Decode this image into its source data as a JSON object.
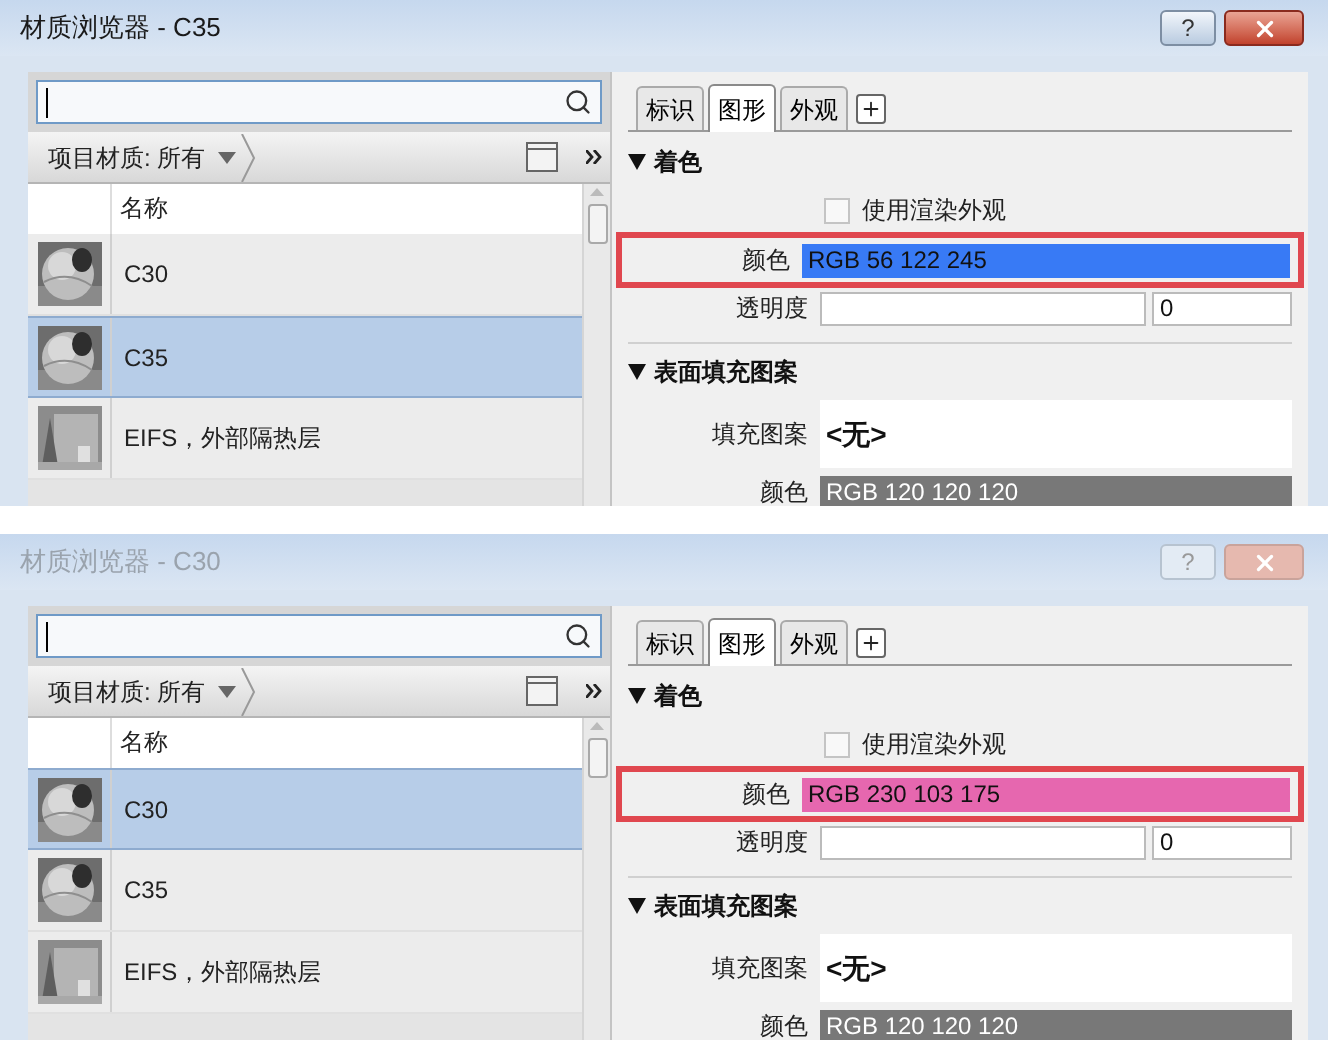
{
  "dialogs": [
    {
      "title": "材质浏览器 - C35",
      "active": true,
      "help": "?",
      "filter": "项目材质: 所有",
      "column": "名称",
      "materials": [
        {
          "name": "C30",
          "selected": false,
          "kind": "sphere"
        },
        {
          "name": "C35",
          "selected": true,
          "kind": "sphere"
        },
        {
          "name": "EIFS，外部隔热层",
          "selected": false,
          "kind": "block"
        }
      ],
      "tabs": [
        {
          "label": "标识",
          "selected": false
        },
        {
          "label": "图形",
          "selected": true
        },
        {
          "label": "外观",
          "selected": false
        }
      ],
      "shading": {
        "title": "着色",
        "render_appearance": {
          "label": "使用渲染外观",
          "checked": false
        },
        "color": {
          "label": "颜色",
          "value": "RGB 56 122 245",
          "color": "#387af5",
          "highlighted": true
        },
        "transparency": {
          "label": "透明度",
          "value": "0"
        }
      },
      "surface": {
        "title": "表面填充图案",
        "pattern": {
          "label": "填充图案",
          "value": "<无>"
        },
        "color": {
          "label": "颜色",
          "value": "RGB 120 120 120",
          "color": "#787878"
        }
      }
    },
    {
      "title": "材质浏览器 - C30",
      "active": false,
      "help": "?",
      "filter": "项目材质: 所有",
      "column": "名称",
      "materials": [
        {
          "name": "C30",
          "selected": true,
          "kind": "sphere"
        },
        {
          "name": "C35",
          "selected": false,
          "kind": "sphere"
        },
        {
          "name": "EIFS，外部隔热层",
          "selected": false,
          "kind": "block"
        }
      ],
      "tabs": [
        {
          "label": "标识",
          "selected": false
        },
        {
          "label": "图形",
          "selected": true
        },
        {
          "label": "外观",
          "selected": false
        }
      ],
      "shading": {
        "title": "着色",
        "render_appearance": {
          "label": "使用渲染外观",
          "checked": false
        },
        "color": {
          "label": "颜色",
          "value": "RGB 230 103 175",
          "color": "#e667af",
          "highlighted": true
        },
        "transparency": {
          "label": "透明度",
          "value": "0"
        }
      },
      "surface": {
        "title": "表面填充图案",
        "pattern": {
          "label": "填充图案",
          "value": "<无>"
        },
        "color": {
          "label": "颜色",
          "value": "RGB 120 120 120",
          "color": "#787878"
        }
      }
    }
  ]
}
